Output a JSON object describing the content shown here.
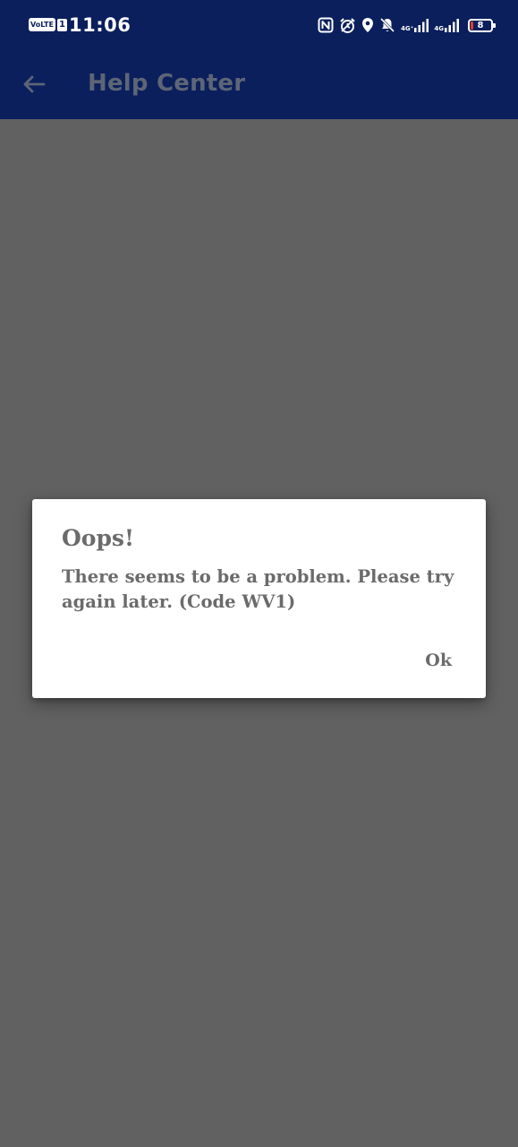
{
  "status_bar": {
    "volte_label": "VoLTE",
    "sim_index": "1",
    "time": "11:06",
    "network_1": "4G⁺",
    "network_2": "4G",
    "battery_level": "8",
    "icons": [
      "nfc-icon",
      "alarm-icon",
      "location-icon",
      "mute-icon",
      "signal-icon",
      "signal-icon",
      "battery-icon"
    ]
  },
  "app_bar": {
    "title": "Help Center",
    "back_icon": "arrow-left-icon"
  },
  "dialog": {
    "title": "Oops!",
    "message": "There seems to be a problem. Please try again later. (Code WV1)",
    "ok_label": "Ok"
  },
  "colors": {
    "app_bar_background": "#0a1f5c",
    "scrim_background": "#616161",
    "dialog_background": "#ffffff",
    "dialog_text": "#6b6b6b",
    "app_title_text": "#5d6577",
    "battery_low": "#e53935"
  }
}
